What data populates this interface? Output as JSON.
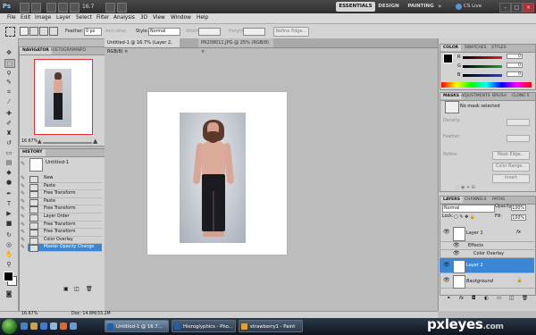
{
  "app": {
    "logo": "Ps",
    "zoom": "16.7",
    "workspaces": [
      "ESSENTIALS",
      "DESIGN",
      "PAINTING"
    ],
    "more": "»",
    "cs_live": "CS Live"
  },
  "menu": [
    "File",
    "Edit",
    "Image",
    "Layer",
    "Select",
    "Filter",
    "Analysis",
    "3D",
    "View",
    "Window",
    "Help"
  ],
  "options": {
    "feather_label": "Feather:",
    "feather_value": "0 px",
    "antialias_label": "Anti-alias",
    "style_label": "Style:",
    "style_value": "Normal",
    "width_label": "Width:",
    "height_label": "Height:",
    "refine_edge": "Refine Edge..."
  },
  "tabs": [
    {
      "label": "Untitled-1 @ 16.7% (Layer 2, RGB/8) ×",
      "active": true
    },
    {
      "label": "PR208011.JPG @ 25% (RGB/8) ×",
      "active": false
    }
  ],
  "navigator": {
    "tabs": [
      "NAVIGATOR",
      "HISTOGRAM",
      "INFO"
    ],
    "zoom": "16.67%"
  },
  "history": {
    "title": "HISTORY",
    "snapshot": "Untitled-1",
    "items": [
      "New",
      "Paste",
      "Free Transform",
      "Paste",
      "Free Transform",
      "Layer Order",
      "Free Transform",
      "Free Transform",
      "Color Overlay",
      "Master Opacity Change"
    ],
    "active_index": 9
  },
  "color_panel": {
    "tabs": [
      "COLOR",
      "SWATCHES",
      "STYLES"
    ],
    "channels": [
      {
        "label": "R",
        "value": "0",
        "color": "#e02020"
      },
      {
        "label": "G",
        "value": "0",
        "color": "#20a020"
      },
      {
        "label": "B",
        "value": "0",
        "color": "#2040e0"
      }
    ]
  },
  "masks_panel": {
    "tabs": [
      "MASKS",
      "ADJUSTMENTS",
      "BRUSH",
      "CLONE S"
    ],
    "status": "No mask selected",
    "labels": [
      "Density:",
      "Feather:",
      "Refine:"
    ],
    "buttons": [
      "Mask Edge...",
      "Color Range...",
      "Invert"
    ]
  },
  "layers_panel": {
    "tabs": [
      "LAYERS",
      "CHANNELS",
      "PATHS"
    ],
    "blend_mode": "Normal",
    "opacity_label": "Opacity:",
    "opacity": "100%",
    "lock_label": "Lock:",
    "fill_label": "Fill:",
    "fill": "100%",
    "layers": [
      {
        "name": "Layer 1",
        "fx": "fx",
        "selected": false
      },
      {
        "name": "Effects",
        "selected": false
      },
      {
        "name": "Color Overlay",
        "selected": false
      },
      {
        "name": "Layer 2",
        "selected": true
      },
      {
        "name": "Background",
        "selected": false
      }
    ]
  },
  "status": {
    "zoom": "16.67%",
    "doc": "Doc: 14.8M/33.2M"
  },
  "taskbar": {
    "tasks": [
      {
        "label": "Untitled-1 @ 16.7...",
        "active": true
      },
      {
        "label": "Hieroglyphics - Pho...",
        "active": false
      },
      {
        "label": "strawberry1 - Paint",
        "active": false
      }
    ]
  },
  "watermark": {
    "text": "pxleyes",
    "suffix": ".com"
  },
  "colors": {
    "accent": "#3b87d6",
    "app_bar": "#3a3a3a",
    "panel": "#d3d3d3"
  }
}
